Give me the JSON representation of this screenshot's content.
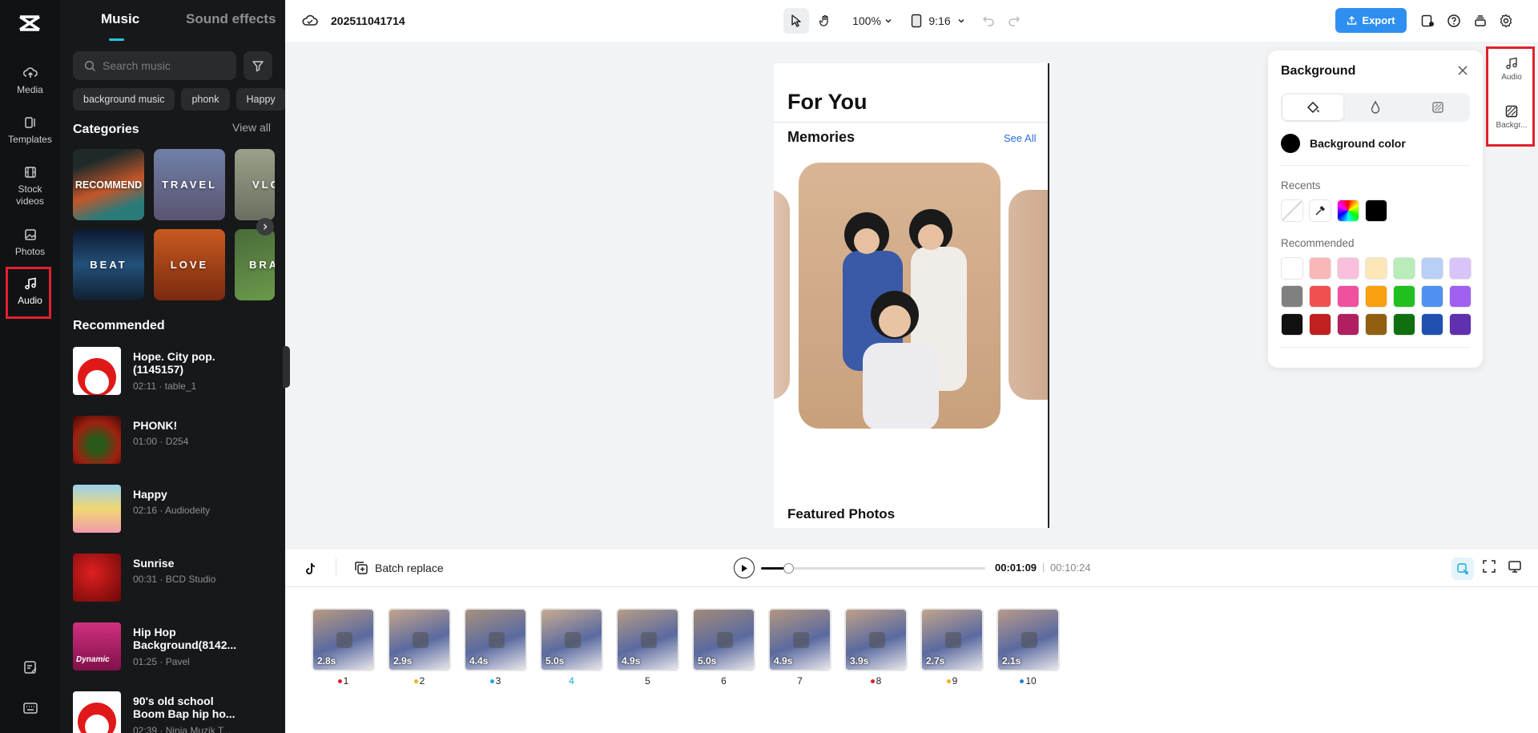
{
  "rail": {
    "items": [
      {
        "label": "Media",
        "icon": "cloud-upload-icon"
      },
      {
        "label": "Templates",
        "icon": "templates-icon"
      },
      {
        "label": "Stock videos",
        "icon": "film-icon"
      },
      {
        "label": "Photos",
        "icon": "image-icon"
      },
      {
        "label": "Audio",
        "icon": "music-note-icon",
        "active": true
      }
    ]
  },
  "panel": {
    "tabs": [
      "Music",
      "Sound effects"
    ],
    "active_tab": "Music",
    "search_placeholder": "Search music",
    "chips": [
      "background music",
      "phonk",
      "Happy"
    ],
    "categories_title": "Categories",
    "view_all": "View all",
    "categories": [
      {
        "label": "RECOMMEND",
        "color": "#3a4a4a"
      },
      {
        "label": "TRAVEL",
        "color": "#5a6080"
      },
      {
        "label": "VLOG",
        "color": "#8a9070"
      },
      {
        "label": "BEAT",
        "color": "#1a3050"
      },
      {
        "label": "LOVE",
        "color": "#b04a1a"
      },
      {
        "label": "BRAVE",
        "color": "#3a5a2a"
      }
    ],
    "recommended_title": "Recommended",
    "tracks": [
      {
        "title": "Hope. City pop. (1145157)",
        "meta": "02:11 · table_1",
        "thumb_color": "#e01818"
      },
      {
        "title": "PHONK!",
        "meta": "01:00 · D254",
        "thumb_color": "#5a1a10"
      },
      {
        "title": "Happy",
        "meta": "02:16 · Audiodeity",
        "thumb_color": "#f2d860"
      },
      {
        "title": "Sunrise",
        "meta": "00:31 · BCD Studio",
        "thumb_color": "#a01010"
      },
      {
        "title": "Hip Hop Background(8142...",
        "meta": "01:25 · Pavel",
        "thumb_color": "#c0206a",
        "badge": "Dynamic"
      },
      {
        "title": "90's old school Boom Bap hip ho...",
        "meta": "02:39 · Ninja Muzik T...",
        "thumb_color": "#e01818"
      }
    ]
  },
  "topbar": {
    "project_name": "202511041714",
    "zoom": "100%",
    "ratio": "9:16",
    "export_label": "Export"
  },
  "canvas": {
    "heading": "For You",
    "section": "Memories",
    "see_all": "See All",
    "featured": "Featured Photos"
  },
  "bg_panel": {
    "title": "Background",
    "bg_color_label": "Background color",
    "recents_label": "Recents",
    "recommended_label": "Recommended",
    "recents": [
      "none",
      "eyedropper",
      "gradient",
      "#000000"
    ],
    "recommended_colors": [
      [
        "#ffffff",
        "#f9b8b8",
        "#f9c0dc",
        "#fde6b8",
        "#b8ecb8",
        "#b8d0f8",
        "#d8c4f8"
      ],
      [
        "#808080",
        "#f05050",
        "#f050a0",
        "#f8a010",
        "#20c020",
        "#5090f0",
        "#a060f0"
      ],
      [
        "#111111",
        "#c02020",
        "#b02060",
        "#906010",
        "#107010",
        "#2050b0",
        "#6030b0"
      ]
    ]
  },
  "right_rail": {
    "items": [
      {
        "label": "Audio",
        "icon": "music-note-icon"
      },
      {
        "label": "Backgr...",
        "icon": "background-icon"
      }
    ]
  },
  "timeline": {
    "batch_replace": "Batch replace",
    "current_time": "00:01:09",
    "total_time": "00:10:24",
    "progress": 0.12,
    "clips": [
      {
        "dur": "2.8s",
        "num": "1",
        "dot": "#e02020"
      },
      {
        "dur": "2.9s",
        "num": "2",
        "dot": "#f0b020"
      },
      {
        "dur": "4.4s",
        "num": "3",
        "dot": "#20a8e0"
      },
      {
        "dur": "5.0s",
        "num": "4",
        "dot": ""
      },
      {
        "dur": "4.9s",
        "num": "5",
        "dot": ""
      },
      {
        "dur": "5.0s",
        "num": "6",
        "dot": ""
      },
      {
        "dur": "4.9s",
        "num": "7",
        "dot": ""
      },
      {
        "dur": "3.9s",
        "num": "8",
        "dot": "#e02020"
      },
      {
        "dur": "2.7s",
        "num": "9",
        "dot": "#f0b020"
      },
      {
        "dur": "2.1s",
        "num": "10",
        "dot": "#2080e0"
      }
    ]
  }
}
